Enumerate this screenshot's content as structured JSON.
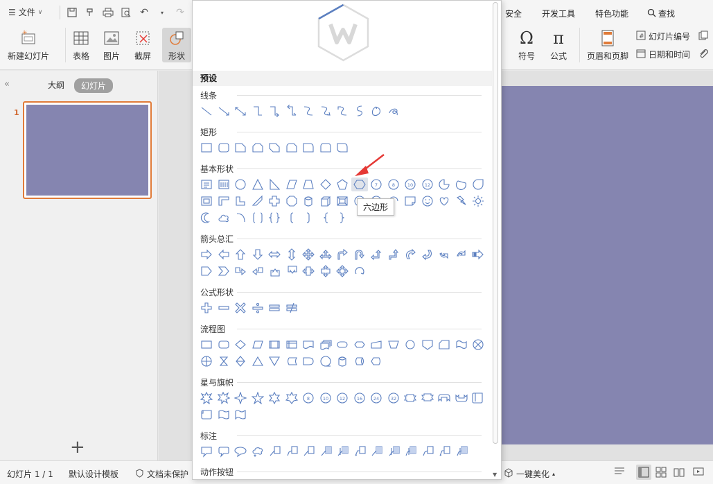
{
  "ribbon": {
    "file_label": "文件",
    "tabs_right": [
      "安全",
      "开发工具",
      "特色功能"
    ],
    "search_label": "查找",
    "buttons": {
      "new_slide": "新建幻灯片",
      "table": "表格",
      "picture": "图片",
      "screenshot": "截屏",
      "shapes": "形状",
      "symbol": "符号",
      "formula": "公式",
      "header_footer": "页眉和页脚",
      "slide_number": "幻灯片编号",
      "date_time": "日期和时间"
    }
  },
  "left_panel": {
    "tab_outline": "大纲",
    "tab_slides": "幻灯片",
    "slide_number": "1",
    "add_symbol": "+"
  },
  "status_bar": {
    "slide_count": "幻灯片 1 / 1",
    "template": "默认设计模板",
    "protection": "文档未保护",
    "beautify": "一键美化"
  },
  "shapes_dropdown": {
    "preset_label": "预设",
    "categories": [
      {
        "name": "线条"
      },
      {
        "name": "矩形"
      },
      {
        "name": "基本形状"
      },
      {
        "name": "箭头总汇"
      },
      {
        "name": "公式形状"
      },
      {
        "name": "流程图"
      },
      {
        "name": "星与旗帜"
      },
      {
        "name": "标注"
      },
      {
        "name": "动作按钮"
      }
    ],
    "tooltip": "六边形"
  },
  "colors": {
    "slide_fill": "#8585b0",
    "accent_orange": "#e07b39",
    "shape_stroke": "#5b7fc0",
    "arrow_red": "#e53935"
  }
}
